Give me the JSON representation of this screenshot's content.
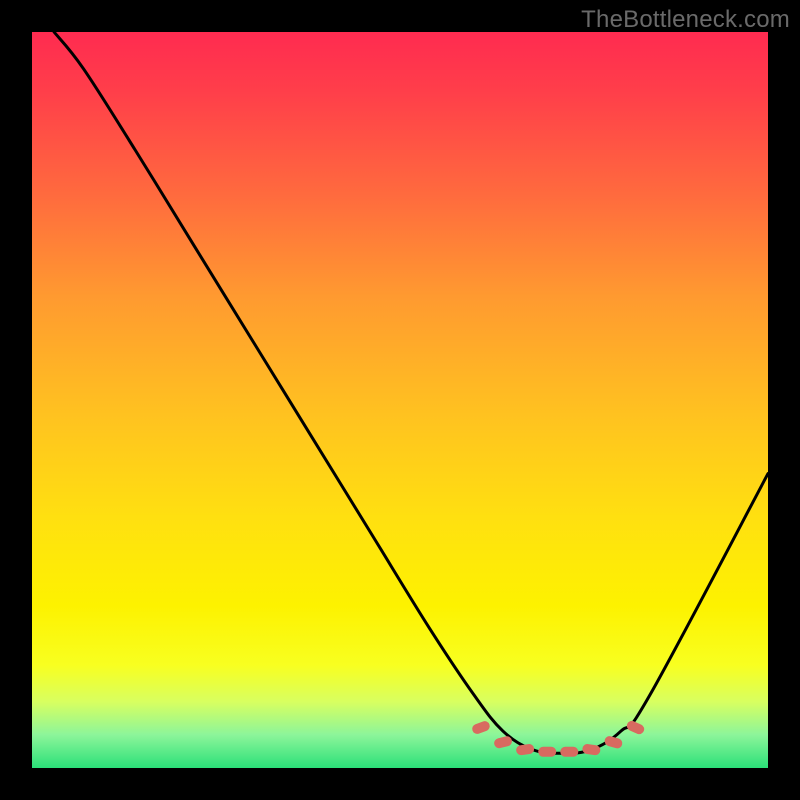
{
  "watermark": "TheBottleneck.com",
  "chart_data": {
    "type": "line",
    "title": "",
    "xlabel": "",
    "ylabel": "",
    "xlim": [
      0,
      100
    ],
    "ylim": [
      0,
      100
    ],
    "grid": false,
    "gradient_stops": [
      {
        "pos": 0,
        "color": "#ff2b50"
      },
      {
        "pos": 8,
        "color": "#ff3e4a"
      },
      {
        "pos": 22,
        "color": "#ff6a3e"
      },
      {
        "pos": 36,
        "color": "#ff9a30"
      },
      {
        "pos": 52,
        "color": "#ffc220"
      },
      {
        "pos": 66,
        "color": "#ffe010"
      },
      {
        "pos": 78,
        "color": "#fdf200"
      },
      {
        "pos": 86,
        "color": "#f8ff20"
      },
      {
        "pos": 91,
        "color": "#d8ff60"
      },
      {
        "pos": 95.5,
        "color": "#8cf59a"
      },
      {
        "pos": 100,
        "color": "#2be079"
      }
    ],
    "series": [
      {
        "name": "bottleneck-curve",
        "x": [
          3,
          7,
          14,
          22,
          30,
          38,
          46,
          54,
          60,
          64,
          68,
          72,
          76,
          80,
          84,
          100
        ],
        "y": [
          100,
          95,
          84,
          71,
          58,
          45,
          32,
          19,
          10,
          5,
          2.5,
          2,
          2.5,
          5,
          10,
          40
        ]
      }
    ],
    "valley_markers": {
      "x": [
        61,
        64,
        67,
        70,
        73,
        76,
        79,
        82
      ],
      "y": [
        5.5,
        3.5,
        2.5,
        2.2,
        2.2,
        2.5,
        3.5,
        5.5
      ],
      "color": "#d86a60"
    }
  }
}
